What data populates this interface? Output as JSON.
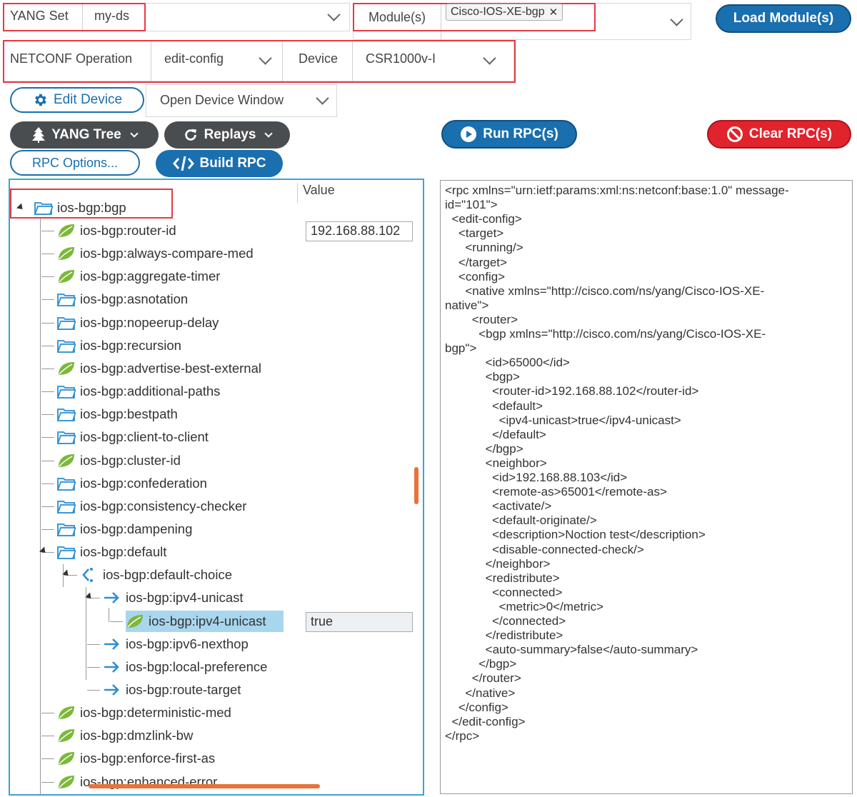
{
  "top": {
    "yang_set_label": "YANG Set",
    "yang_set_value": "my-ds",
    "modules_label": "Module(s)",
    "module_tag": "Cisco-IOS-XE-bgp",
    "load_modules": "Load Module(s)",
    "netconf_label": "NETCONF Operation",
    "netconf_value": "edit-config",
    "device_label": "Device",
    "device_value": "CSR1000v-I",
    "edit_device": "Edit Device",
    "open_device_window": "Open Device Window"
  },
  "toolbar": {
    "yang_tree": "YANG Tree",
    "replays": "Replays",
    "run_rpc": "Run RPC(s)",
    "clear_rpc": "Clear RPC(s)",
    "rpc_options": "RPC Options...",
    "build_rpc": "Build RPC"
  },
  "tree": {
    "value_header": "Value",
    "root": "ios-bgp:bgp",
    "router_id_value": "192.168.88.102",
    "ipv4_value": "true",
    "nodes": [
      "ios-bgp:router-id",
      "ios-bgp:always-compare-med",
      "ios-bgp:aggregate-timer",
      "ios-bgp:asnotation",
      "ios-bgp:nopeerup-delay",
      "ios-bgp:recursion",
      "ios-bgp:advertise-best-external",
      "ios-bgp:additional-paths",
      "ios-bgp:bestpath",
      "ios-bgp:client-to-client",
      "ios-bgp:cluster-id",
      "ios-bgp:confederation",
      "ios-bgp:consistency-checker",
      "ios-bgp:dampening",
      "ios-bgp:default",
      "ios-bgp:default-choice",
      "ios-bgp:ipv4-unicast",
      "ios-bgp:ipv4-unicast",
      "ios-bgp:ipv6-nexthop",
      "ios-bgp:local-preference",
      "ios-bgp:route-target",
      "ios-bgp:deterministic-med",
      "ios-bgp:dmzlink-bw",
      "ios-bgp:enforce-first-as",
      "ios-bgp:enhanced-error"
    ]
  },
  "xml": {
    "lines": [
      "<rpc xmlns=\"urn:ietf:params:xml:ns:netconf:base:1.0\" message-",
      "id=\"101\">",
      "  <edit-config>",
      "    <target>",
      "      <running/>",
      "    </target>",
      "    <config>",
      "      <native xmlns=\"http://cisco.com/ns/yang/Cisco-IOS-XE-",
      "native\">",
      "        <router>",
      "          <bgp xmlns=\"http://cisco.com/ns/yang/Cisco-IOS-XE-",
      "bgp\">",
      "            <id>65000</id>",
      "            <bgp>",
      "              <router-id>192.168.88.102</router-id>",
      "              <default>",
      "                <ipv4-unicast>true</ipv4-unicast>",
      "              </default>",
      "            </bgp>",
      "            <neighbor>",
      "              <id>192.168.88.103</id>",
      "              <remote-as>65001</remote-as>",
      "              <activate/>",
      "              <default-originate/>",
      "              <description>Noction test</description>",
      "              <disable-connected-check/>",
      "            </neighbor>",
      "            <redistribute>",
      "              <connected>",
      "                <metric>0</metric>",
      "              </connected>",
      "            </redistribute>",
      "            <auto-summary>false</auto-summary>",
      "          </bgp>",
      "        </router>",
      "      </native>",
      "    </config>",
      "  </edit-config>",
      "</rpc>"
    ]
  },
  "colors": {
    "primary": "#1a6fae",
    "danger": "#e0232c",
    "dark": "#4a4d4f",
    "highlight": "#e53945",
    "tree_border": "#3aa3d8",
    "leaf_green": "#7cb83a",
    "folder_blue": "#2d8fd4",
    "scroll_orange": "#e8733a"
  },
  "icons": [
    "gear-icon",
    "tree-icon",
    "refresh-icon",
    "play-icon",
    "ban-icon",
    "code-icon",
    "folder-icon",
    "leaf-icon",
    "arrow-icon",
    "choice-icon",
    "chevron-down-icon",
    "close-icon"
  ]
}
